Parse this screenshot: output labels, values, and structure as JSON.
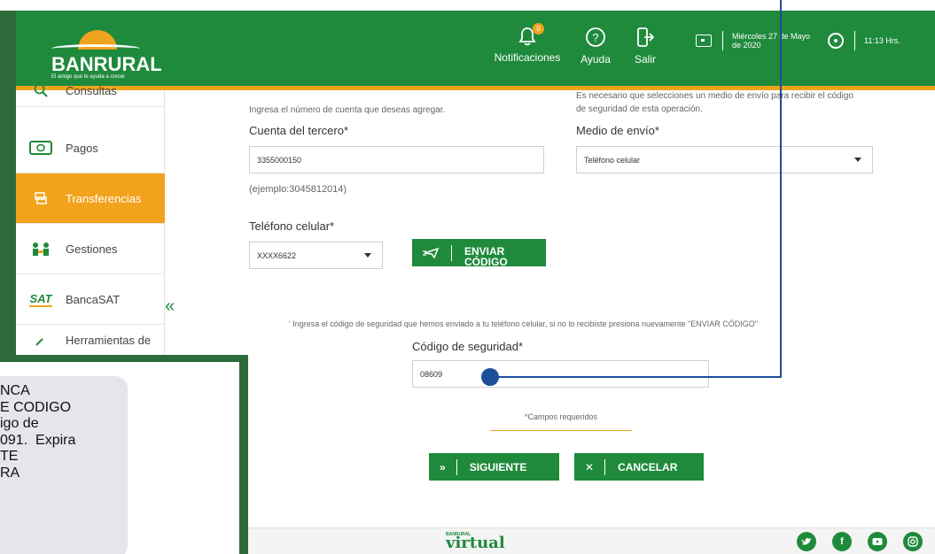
{
  "header": {
    "logo_text": "BANRURAL",
    "logo_tagline": "El amigo que te ayuda a crecer",
    "notifications_label": "Notificaciones",
    "notifications_count": "0",
    "help_label": "Ayuda",
    "logout_label": "Salir",
    "date_line1": "Miércoles 27 de Mayo",
    "date_line2": "de 2020",
    "time": "11:13 Hrs.",
    "colors": {
      "primary": "#1f8a3c",
      "accent": "#f0a31c"
    }
  },
  "sidebar": {
    "items": [
      {
        "label": "Consultas",
        "icon": "search-icon"
      },
      {
        "label": "Pagos",
        "icon": "money-icon"
      },
      {
        "label": "Transferencias",
        "icon": "transfer-icon",
        "active": true
      },
      {
        "label": "Gestiones",
        "icon": "people-icon"
      },
      {
        "label": "BancaSAT",
        "icon": "sat-icon"
      },
      {
        "label": "Herramientas de",
        "icon": "tools-icon"
      }
    ],
    "sat_logo": "SAT",
    "collapse_icon": "«"
  },
  "form": {
    "account_hint": "Ingresa el número de cuenta que deseas agregar.",
    "account_label": "Cuenta del tercero*",
    "account_value": "3355000150",
    "account_example": "(ejemplo:3045812014)",
    "phone_label": "Teléfono celular*",
    "phone_value": "XXXX6622",
    "send_code_line1": "ENVIAR",
    "send_code_line2": "CÓDIGO",
    "medium_hint_line1": "Es necesario que selecciones un medio de envío para recibir el código",
    "medium_hint_line2": "de seguridad de esta operación.",
    "medium_label": "Medio de envío*",
    "medium_value": "Teléfono celular",
    "security_hint": "' Ingresa el código de seguridad que hemos enviado a tu teléfono celular, si no lo recibiste presiona nuevamente \"ENVIAR CÓDIGO\"",
    "security_label": "Código de seguridad*",
    "security_value": "08609",
    "required_note": "*Campos requeridos",
    "next_label": "SIGUIENTE",
    "next_icon": "»",
    "cancel_label": "CANCELAR",
    "cancel_icon": "✕"
  },
  "footer": {
    "logo_small": "BANRURAL",
    "logo_text": "virtual",
    "social": [
      "twitter-icon",
      "facebook-icon",
      "youtube-icon",
      "instagram-icon"
    ]
  },
  "sms": {
    "text": "NCA\nE CODIGO\nigo de\n091.  Expira\nTE\nRA"
  }
}
